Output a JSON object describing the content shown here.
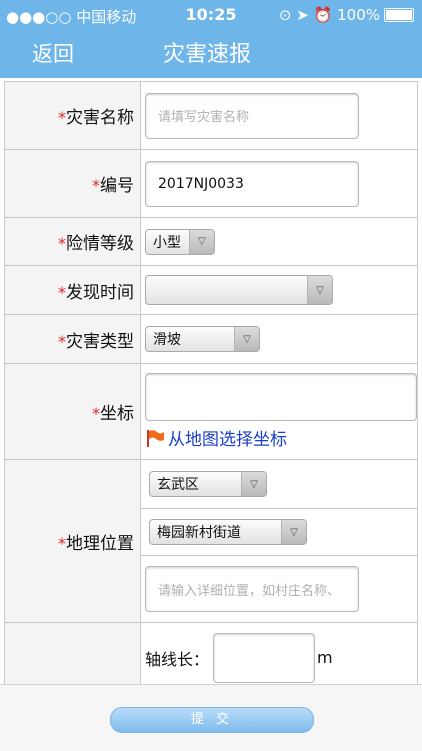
{
  "status_bar": {
    "signal_carrier": "●●●○○ 中国移动",
    "time": "10:25",
    "battery": "100%"
  },
  "nav": {
    "back_label": "返回",
    "title": "灾害速报"
  },
  "form": {
    "required_mark": "*",
    "disaster_name": {
      "label": "灾害名称",
      "placeholder": "请填写灾害名称"
    },
    "code": {
      "label": "编号",
      "value": "2017NJ0033"
    },
    "danger_level": {
      "label": "险情等级",
      "selected": "小型"
    },
    "discovery_time": {
      "label": "发现时间",
      "selected": ""
    },
    "disaster_type": {
      "label": "灾害类型",
      "selected": "滑坡"
    },
    "coordinates": {
      "label": "坐标",
      "value": "",
      "map_link": "从地图选择坐标"
    },
    "location": {
      "label": "地理位置",
      "district": "玄武区",
      "street": "梅园新村街道",
      "detail_placeholder": "请输入详细位置，如村庄名称、"
    },
    "axis_length": {
      "label": "轴线长：",
      "unit": "m",
      "value": ""
    }
  },
  "footer": {
    "submit_label": "提 交"
  },
  "colors": {
    "nav_bg": "#6eb5ea",
    "required": "#e0262c",
    "link": "#1a3fc9"
  }
}
